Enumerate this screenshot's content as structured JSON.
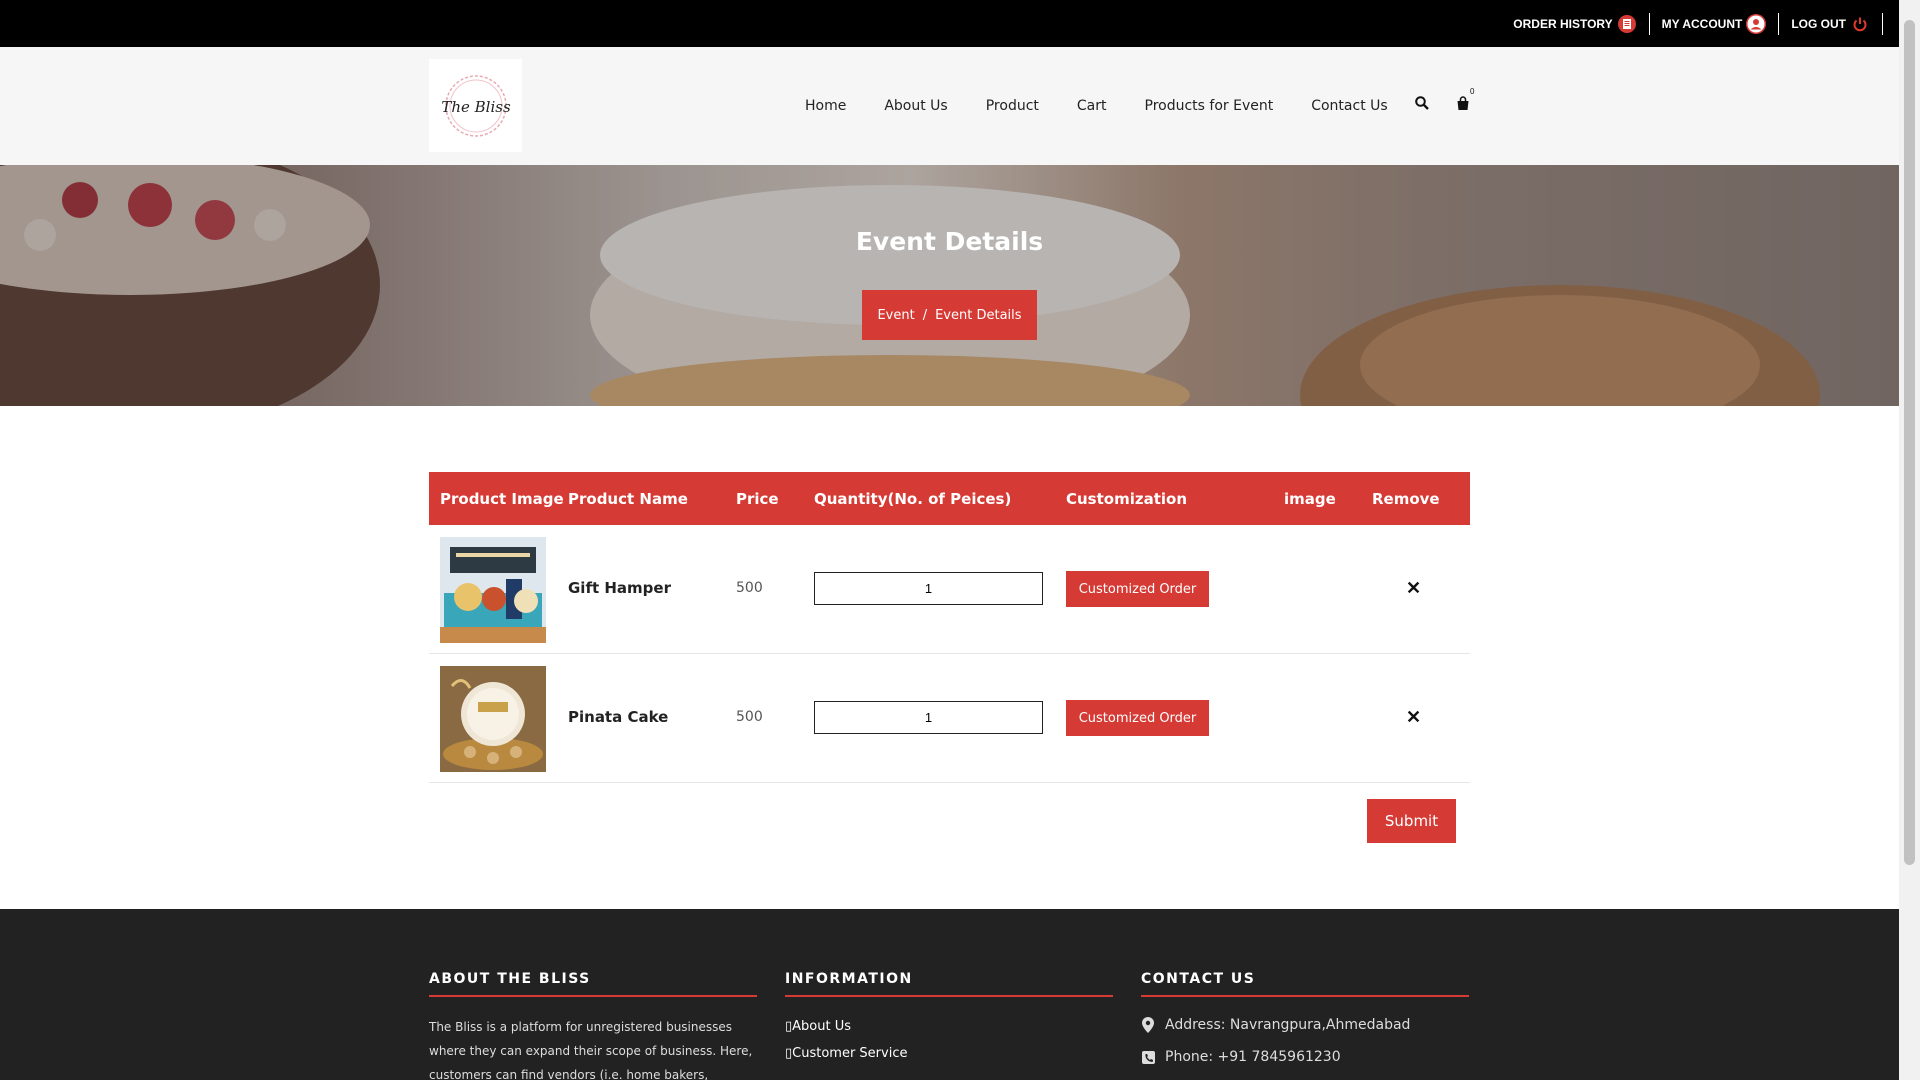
{
  "topbar": {
    "order_history": "ORDER HISTORY",
    "my_account": "MY ACCOUNT",
    "log_out": "LOG OUT"
  },
  "header": {
    "logo_text": "The Bliss",
    "nav": [
      "Home",
      "About Us",
      "Product",
      "Cart",
      "Products for Event",
      "Contact Us"
    ],
    "cart_count": "0"
  },
  "hero": {
    "title": "Event Details",
    "breadcrumb": [
      "Event",
      "Event Details"
    ],
    "breadcrumb_sep": "/"
  },
  "table": {
    "headers": [
      "Product Image",
      "Product Name",
      "Price",
      "Quantity(No. of Peices)",
      "Customization",
      "image",
      "Remove"
    ],
    "rows": [
      {
        "name": "Gift Hamper",
        "price": "500",
        "qty": "1",
        "customize_label": "Customized Order",
        "remove_icon": "close-icon"
      },
      {
        "name": "Pinata Cake",
        "price": "500",
        "qty": "1",
        "customize_label": "Customized Order",
        "remove_icon": "close-icon"
      }
    ]
  },
  "submit_label": "Submit",
  "footer": {
    "about_heading": "ABOUT THE BLISS",
    "about_text": "The Bliss is a platform for unregistered businesses where they can expand their scope of business. Here, customers can find vendors (i.e. home bakers, Decorators, Snacks",
    "info_heading": "INFORMATION",
    "info_links": [
      "About Us",
      "Customer Service"
    ],
    "contact_heading": "CONTACT US",
    "address": "Address: Navrangpura,Ahmedabad",
    "phone": "Phone: +91 7845961230"
  },
  "colors": {
    "accent": "#d63a35",
    "topbar": "#000000",
    "footer": "#222222"
  }
}
